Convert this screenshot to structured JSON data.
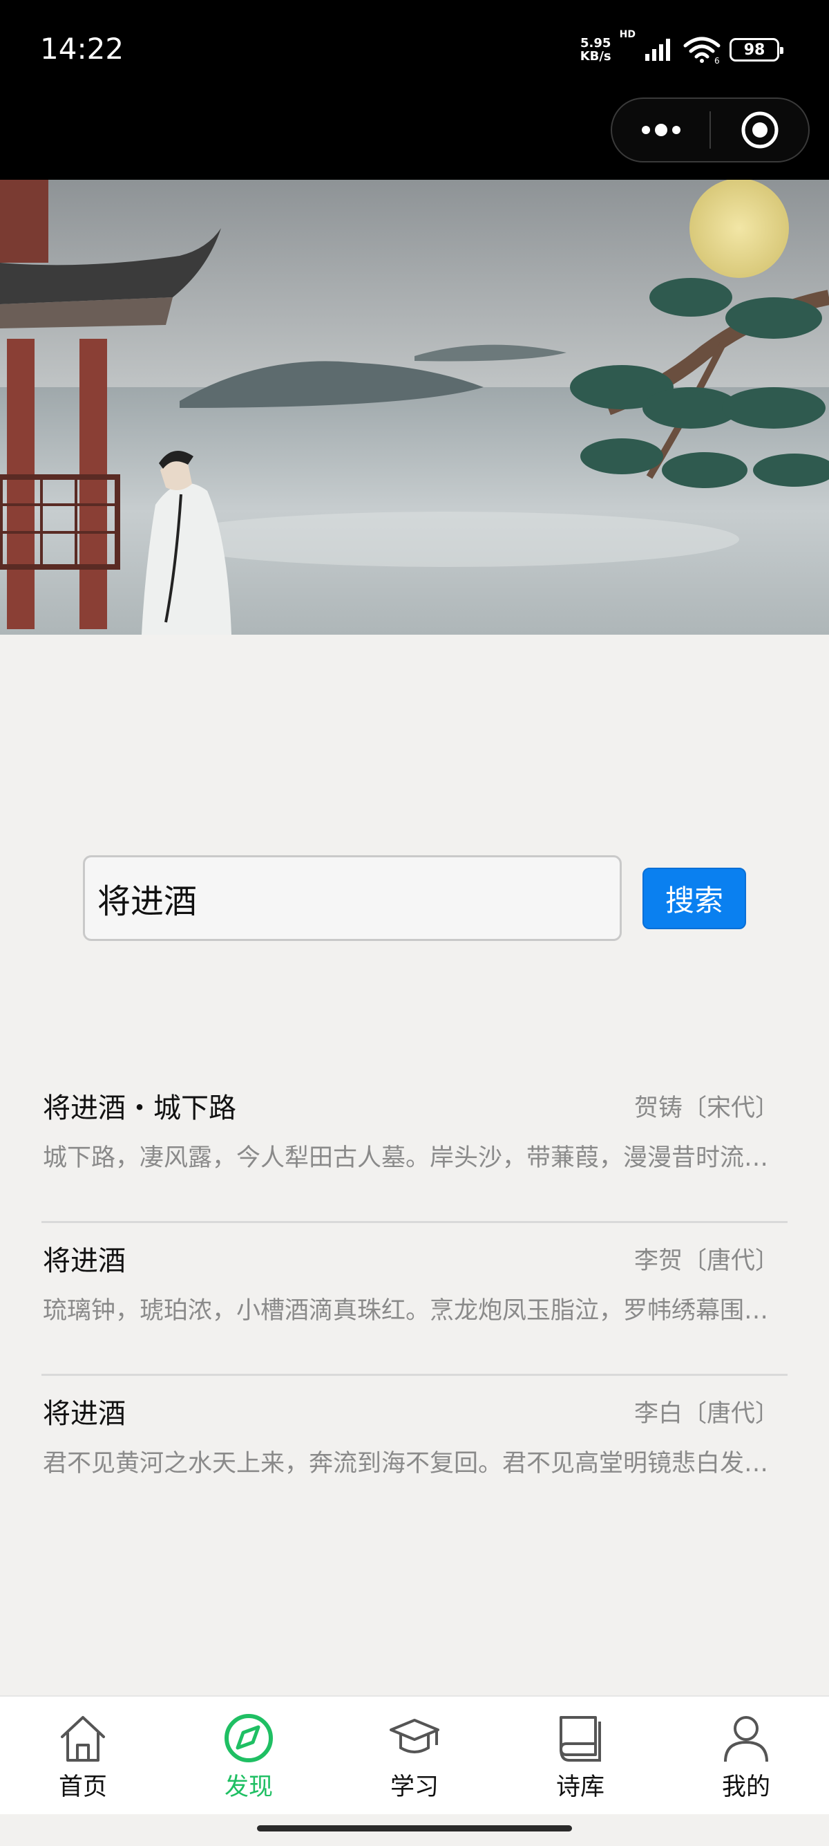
{
  "status_bar": {
    "time": "14:22",
    "net_speed_value": "5.95",
    "net_speed_unit": "KB/s",
    "hd": "HD",
    "battery": "98"
  },
  "search": {
    "value": "将进酒",
    "button_label": "搜索"
  },
  "results": [
    {
      "title": "将进酒・城下路",
      "author": "贺铸〔宋代〕",
      "excerpt": "城下路，凄风露，今人犁田古人墓。岸头沙，带蒹葭，漫漫昔时流水…"
    },
    {
      "title": "将进酒",
      "author": "李贺〔唐代〕",
      "excerpt": "琉璃钟，琥珀浓，小槽酒滴真珠红。烹龙炮凤玉脂泣，罗帏绣幕围香…"
    },
    {
      "title": "将进酒",
      "author": "李白〔唐代〕",
      "excerpt": "君不见黄河之水天上来，奔流到海不复回。君不见高堂明镜悲白发，…"
    }
  ],
  "tabbar": {
    "items": [
      {
        "label": "首页",
        "icon": "home-icon"
      },
      {
        "label": "发现",
        "icon": "compass-icon"
      },
      {
        "label": "学习",
        "icon": "graduation-cap-icon"
      },
      {
        "label": "诗库",
        "icon": "book-icon"
      },
      {
        "label": "我的",
        "icon": "user-icon"
      }
    ],
    "active_index": 1,
    "active_color": "#1fbf63"
  },
  "colors": {
    "search_button": "#0a80f0",
    "page_background": "#f2f1ef"
  }
}
